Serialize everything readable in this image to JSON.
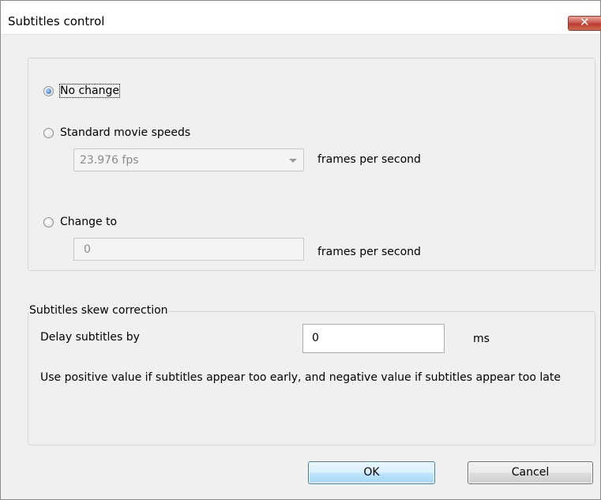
{
  "window": {
    "title": "Subtitles control",
    "close_glyph": "✕"
  },
  "frame_rate": {
    "options": {
      "no_change": "No change",
      "standard": "Standard movie speeds",
      "change_to": "Change to"
    },
    "selected": "no_change",
    "standard_select_value": "23.976 fps",
    "standard_unit": "frames per second",
    "change_to_value": "0",
    "change_to_unit": "frames per second"
  },
  "skew": {
    "group_title": "Subtitles skew correction",
    "delay_label": "Delay subtitles by",
    "delay_value": "0",
    "delay_unit": "ms",
    "hint": "Use positive value if subtitles appear  too early, and negative value if subtitles appear too late"
  },
  "buttons": {
    "ok": "OK",
    "cancel": "Cancel"
  }
}
